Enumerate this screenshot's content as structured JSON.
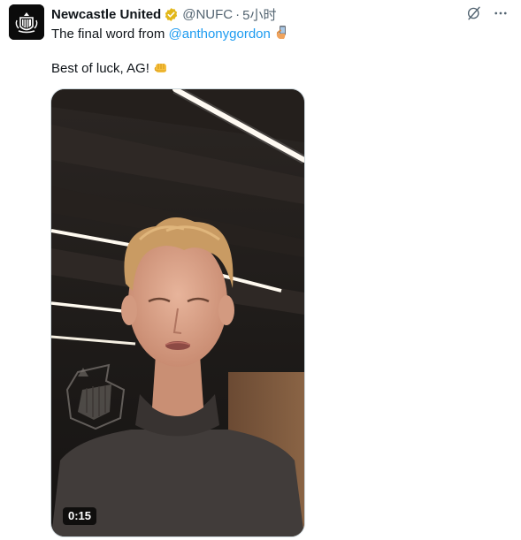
{
  "tweet": {
    "author_name": "Newcastle United",
    "handle": "@NUFC",
    "separator": "·",
    "time": "5小时",
    "text_before_mention": "The final word from ",
    "mention": "@anthonygordon",
    "line2_text": "Best of luck, AG!",
    "emoji_1_icon": "selfie-hand-icon",
    "emoji_2_icon": "raised-fist-icon"
  },
  "media": {
    "type": "video",
    "duration": "0:15"
  },
  "icons": {
    "verified": "verified-badge-icon",
    "grok": "grok-icon",
    "more": "more-icon"
  },
  "colors": {
    "link": "#1d9bf0",
    "verified_gold": "#e2b719",
    "secondary_text": "#536471"
  }
}
